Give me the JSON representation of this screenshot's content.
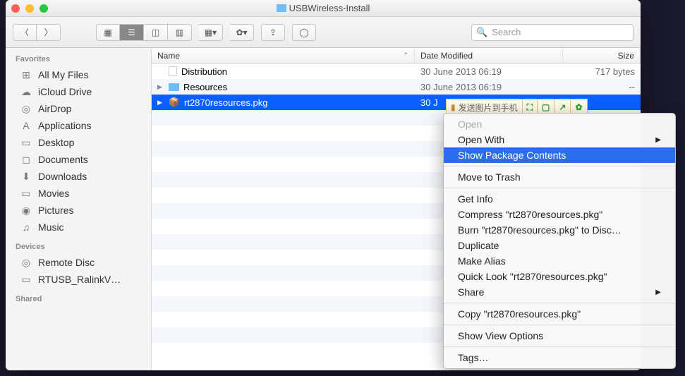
{
  "window": {
    "title": "USBWireless-Install"
  },
  "toolbar": {
    "search_placeholder": "Search"
  },
  "sidebar": {
    "section_favorites": "Favorites",
    "section_devices": "Devices",
    "section_shared": "Shared",
    "favorites": [
      {
        "label": "All My Files",
        "icon": "⊞"
      },
      {
        "label": "iCloud Drive",
        "icon": "☁"
      },
      {
        "label": "AirDrop",
        "icon": "◎"
      },
      {
        "label": "Applications",
        "icon": "A"
      },
      {
        "label": "Desktop",
        "icon": "▭"
      },
      {
        "label": "Documents",
        "icon": "◻"
      },
      {
        "label": "Downloads",
        "icon": "⬇"
      },
      {
        "label": "Movies",
        "icon": "▭"
      },
      {
        "label": "Pictures",
        "icon": "◉"
      },
      {
        "label": "Music",
        "icon": "♫"
      }
    ],
    "devices": [
      {
        "label": "Remote Disc",
        "icon": "◎"
      },
      {
        "label": "RTUSB_RalinkV…",
        "icon": "▭"
      }
    ]
  },
  "columns": {
    "name": "Name",
    "date": "Date Modified",
    "size": "Size"
  },
  "rows": [
    {
      "name": "Distribution",
      "date": "30 June 2013 06:19",
      "size": "717 bytes",
      "type": "doc",
      "expandable": false
    },
    {
      "name": "Resources",
      "date": "30 June 2013 06:19",
      "size": "--",
      "type": "folder",
      "expandable": true
    },
    {
      "name": "rt2870resources.pkg",
      "date": "30 J",
      "size": "",
      "type": "pkg",
      "expandable": true,
      "selected": true
    }
  ],
  "overlay": {
    "label": "发送图片到手机"
  },
  "context_menu": {
    "open": "Open",
    "open_with": "Open With",
    "show_pkg": "Show Package Contents",
    "trash": "Move to Trash",
    "get_info": "Get Info",
    "compress": "Compress \"rt2870resources.pkg\"",
    "burn": "Burn \"rt2870resources.pkg\" to Disc…",
    "duplicate": "Duplicate",
    "alias": "Make Alias",
    "quicklook": "Quick Look \"rt2870resources.pkg\"",
    "share": "Share",
    "copy": "Copy \"rt2870resources.pkg\"",
    "view_opts": "Show View Options",
    "tags": "Tags…"
  }
}
